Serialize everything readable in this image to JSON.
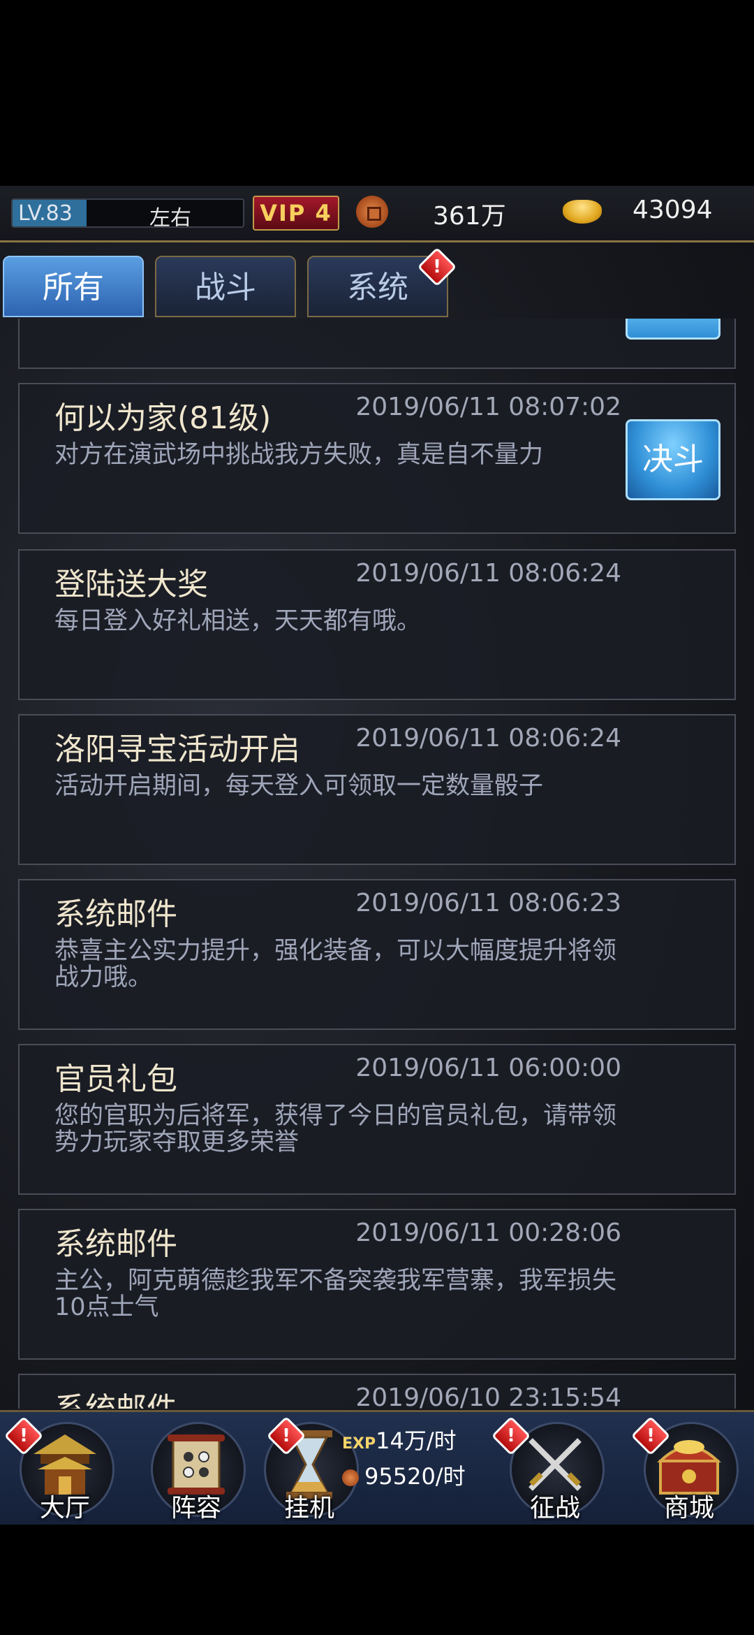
{
  "topbar": {
    "level_label": "LV.83",
    "level_progress": 0.32,
    "player_name": "左右",
    "vip_label": "VIP 4",
    "coin_value": "361万",
    "gold_value": "43094"
  },
  "tabs": [
    {
      "label": "所有",
      "active": true
    },
    {
      "label": "战斗",
      "active": false
    },
    {
      "label": "系统",
      "active": false,
      "alert": true
    }
  ],
  "mails": [
    {
      "title": "何以为家(81级)",
      "time": "2019/06/11 08:07:02",
      "body": "对方在演武场中挑战我方失败，真是自不量力",
      "button": "决斗"
    },
    {
      "title": "登陆送大奖",
      "time": "2019/06/11 08:06:24",
      "body": "每日登入好礼相送，天天都有哦。"
    },
    {
      "title": "洛阳寻宝活动开启",
      "time": "2019/06/11 08:06:24",
      "body": "活动开启期间，每天登入可领取一定数量骰子"
    },
    {
      "title": "系统邮件",
      "time": "2019/06/11 08:06:23",
      "body": "恭喜主公实力提升，强化装备，可以大幅度提升将领战力哦。"
    },
    {
      "title": "官员礼包",
      "time": "2019/06/11 06:00:00",
      "body": "您的官职为后将军，获得了今日的官员礼包，请带领势力玩家夺取更多荣誉"
    },
    {
      "title": "系统邮件",
      "time": "2019/06/11 00:28:06",
      "body": "主公，阿克萌德趁我军不备突袭我军营寨，我军损失10点士气"
    },
    {
      "title": "系统邮件",
      "time": "2019/06/10 23:15:54",
      "body": ""
    }
  ],
  "bottom_nav": {
    "hall": "大厅",
    "formation": "阵容",
    "idle": "挂机",
    "campaign": "征战",
    "shop": "商城",
    "idle_exp_label": "EXP",
    "idle_exp_rate": "14万/时",
    "idle_coin_rate": "95520/时"
  },
  "alert_symbol": "!"
}
